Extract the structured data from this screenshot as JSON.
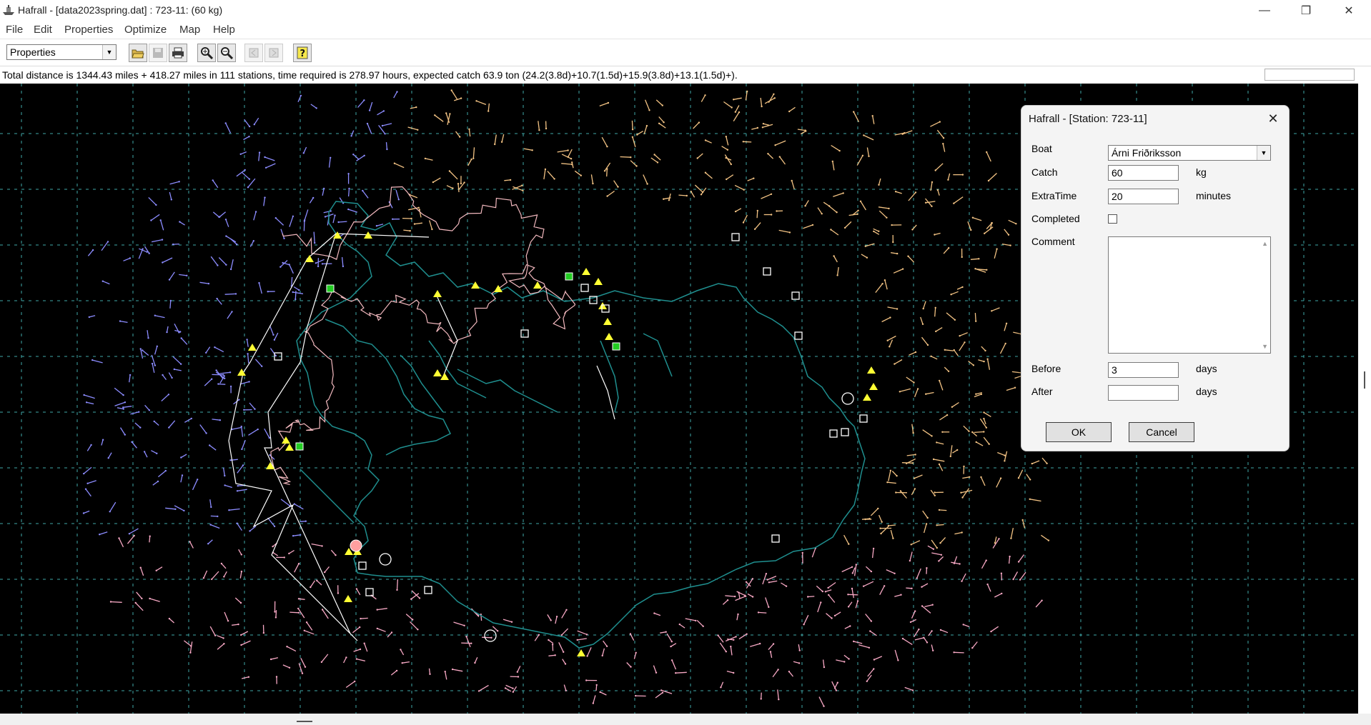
{
  "window": {
    "title": "Hafrall - [data2023spring.dat] : 723-11: (60 kg)",
    "minimize_glyph": "—",
    "restore_glyph": "❐",
    "close_glyph": "✕"
  },
  "menu": {
    "file": "File",
    "edit": "Edit",
    "properties": "Properties",
    "optimize": "Optimize",
    "map": "Map",
    "help": "Help"
  },
  "toolbar": {
    "view_select": "Properties",
    "buttons": [
      "open-icon",
      "save-icon",
      "print-icon",
      "zoom-in-icon",
      "zoom-out-icon",
      "back-icon",
      "forward-icon",
      "help-icon"
    ]
  },
  "status": {
    "summary": "Total distance is 1344.43 miles + 418.27 miles in 111 stations, time required is 278.97 hours, expected catch 63.9 ton (24.2(3.8d)+10.7(1.5d)+15.9(3.8d)+13.1(1.5d)+)."
  },
  "map": {
    "background": "#000000",
    "grid_color": "#3fa9a9",
    "coast_color": "#1f8f8f",
    "route_color": "#ffffff",
    "north_track_color": "#f3b9bf",
    "arrow_colors": {
      "west": "#8c8cff",
      "east": "#f2c283",
      "south": "#f7a8c4"
    },
    "marker_colors": {
      "triangle": "#ffff33",
      "filled_square": "#22cc22",
      "selected_circle": "#ff9f9f"
    }
  },
  "dialog": {
    "title": "Hafrall - [Station: 723-11]",
    "boat_label": "Boat",
    "boat_value": "Árni Friðriksson",
    "catch_label": "Catch",
    "catch_value": "60",
    "catch_unit": "kg",
    "extratime_label": "ExtraTime",
    "extratime_value": "20",
    "extratime_unit": "minutes",
    "completed_label": "Completed",
    "completed": false,
    "comment_label": "Comment",
    "comment_value": "",
    "before_label": "Before",
    "before_value": "3",
    "before_unit": "days",
    "after_label": "After",
    "after_value": "",
    "after_unit": "days",
    "ok_label": "OK",
    "cancel_label": "Cancel"
  }
}
